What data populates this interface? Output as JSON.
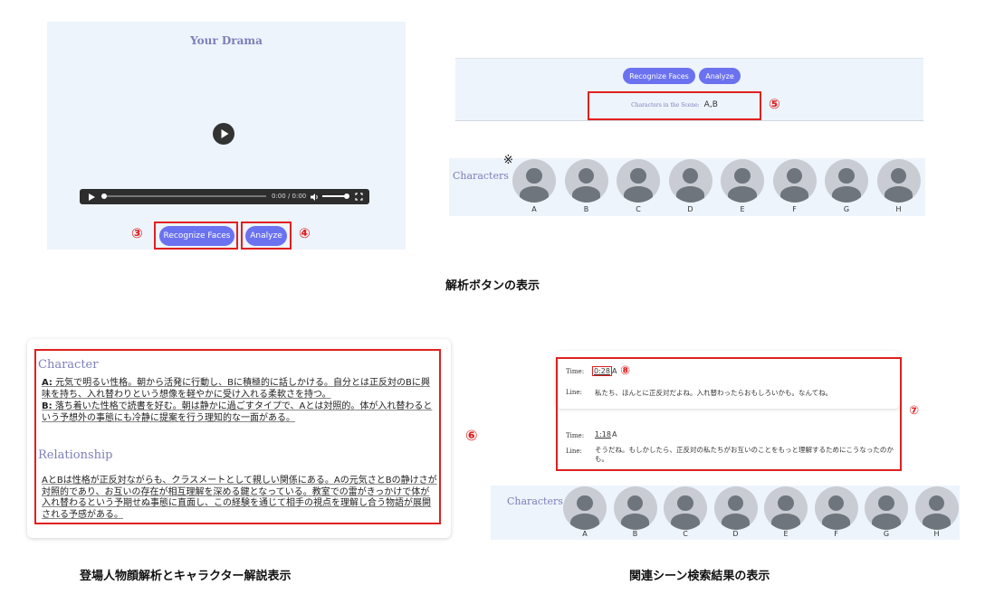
{
  "panel1": {
    "title": "Your Drama",
    "time": "0:00 / 0:00",
    "recognize_label": "Recognize Faces",
    "analyze_label": "Analyze",
    "num_recognize": "③",
    "num_analyze": "④"
  },
  "panel2": {
    "recognize_label": "Recognize Faces",
    "analyze_label": "Analyze",
    "scene_label": "Characters in the Scene:",
    "scene_value": "A,B",
    "num_scene": "⑤",
    "mark": "※",
    "characters_title": "Characters",
    "avatars": [
      "A",
      "B",
      "C",
      "D",
      "E",
      "F",
      "G",
      "H"
    ]
  },
  "caption1": "解析ボタンの表示",
  "panel3": {
    "character_title": "Character",
    "a_label": "A:",
    "a_text": "元気で明るい性格。朝から活発に行動し、Bに積極的に話しかける。自分とは正反対のBに興味を持ち、入れ替わりという想像を軽やかに受け入れる柔軟さを持つ。",
    "b_label": "B:",
    "b_text": "落ち着いた性格で読書を好む。朝は静かに過ごすタイプで、Aとは対照的。体が入れ替わるという予想外の事態にも冷静に提案を行う理知的な一面がある。",
    "relationship_title": "Relationship",
    "relationship_text": "AとBは性格が正反対ながらも、クラスメートとして親しい関係にある。Aの元気さとBの静けさが対照的であり、お互いの存在が相互理解を深める鍵となっている。教室での雷がきっかけで体が入れ替わるという予期せぬ事態に直面し、この経験を通じて相手の視点を理解し合う物語が展開される予感がある。",
    "num": "⑥"
  },
  "caption2": "登場人物顔解析とキャラクター解説表示",
  "panel4": {
    "time_label": "Time:",
    "line_label": "Line:",
    "r1_time": "0:28",
    "r1_char": "A",
    "r1_line": "私たち、ほんとに正反対だよね。入れ替わったらおもしろいかも。なんてね。",
    "r2_time": "1:18",
    "r2_char": "A",
    "r2_line": "そうだね。もしかしたら、正反対の私たちがお互いのことをもっと理解するためにこうなったのかも。",
    "num_time": "⑧",
    "num_results": "⑦",
    "characters_title": "Characters",
    "avatars": [
      "A",
      "B",
      "C",
      "D",
      "E",
      "F",
      "G",
      "H"
    ]
  },
  "caption3": "関連シーン検索結果の表示",
  "colors": {
    "accent": "#6b72f0",
    "highlight": "#e02020",
    "panel_bg": "#eef4fc"
  }
}
